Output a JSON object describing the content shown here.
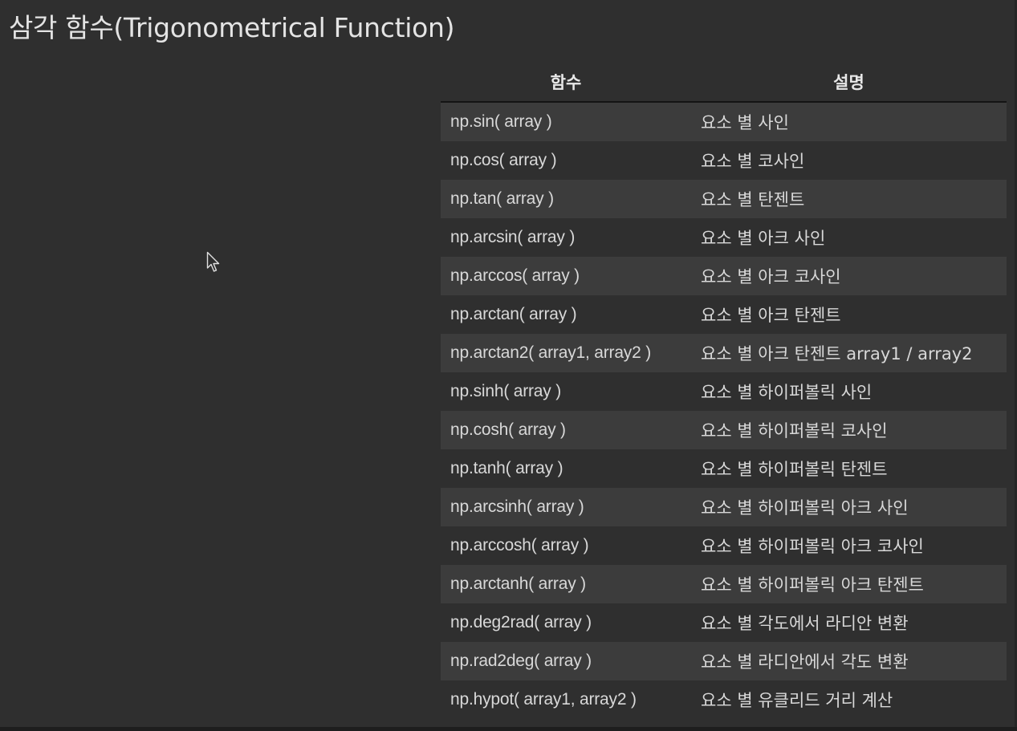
{
  "page": {
    "title": "삼각 함수(Trigonometrical Function)"
  },
  "table": {
    "headers": [
      "함수",
      "설명"
    ],
    "rows": [
      {
        "fn": "np.sin( array )",
        "desc": "요소 별 사인"
      },
      {
        "fn": "np.cos( array )",
        "desc": "요소 별 코사인"
      },
      {
        "fn": "np.tan( array )",
        "desc": "요소 별 탄젠트"
      },
      {
        "fn": "np.arcsin( array )",
        "desc": "요소 별 아크 사인"
      },
      {
        "fn": "np.arccos( array )",
        "desc": "요소 별 아크 코사인"
      },
      {
        "fn": "np.arctan( array )",
        "desc": "요소 별 아크 탄젠트"
      },
      {
        "fn": "np.arctan2( array1, array2 )",
        "desc": "요소 별 아크 탄젠트 array1 / array2"
      },
      {
        "fn": "np.sinh( array )",
        "desc": "요소 별 하이퍼볼릭 사인"
      },
      {
        "fn": "np.cosh( array )",
        "desc": "요소 별 하이퍼볼릭 코사인"
      },
      {
        "fn": "np.tanh( array )",
        "desc": "요소 별 하이퍼볼릭 탄젠트"
      },
      {
        "fn": "np.arcsinh( array )",
        "desc": "요소 별 하이퍼볼릭 아크 사인"
      },
      {
        "fn": "np.arccosh( array )",
        "desc": "요소 별 하이퍼볼릭 아크 코사인"
      },
      {
        "fn": "np.arctanh( array )",
        "desc": "요소 별 하이퍼볼릭 아크 탄젠트"
      },
      {
        "fn": "np.deg2rad( array )",
        "desc": "요소 별 각도에서 라디안 변환"
      },
      {
        "fn": "np.rad2deg( array )",
        "desc": "요소 별 라디안에서 각도 변환"
      },
      {
        "fn": "np.hypot( array1, array2 )",
        "desc": "요소 별 유클리드 거리 계산"
      }
    ]
  },
  "colors": {
    "background": "#2f2f2f",
    "stripe": "#3c3c3c",
    "text": "#d8d8d8"
  },
  "icons": {
    "cursor": "mouse-pointer-icon"
  }
}
